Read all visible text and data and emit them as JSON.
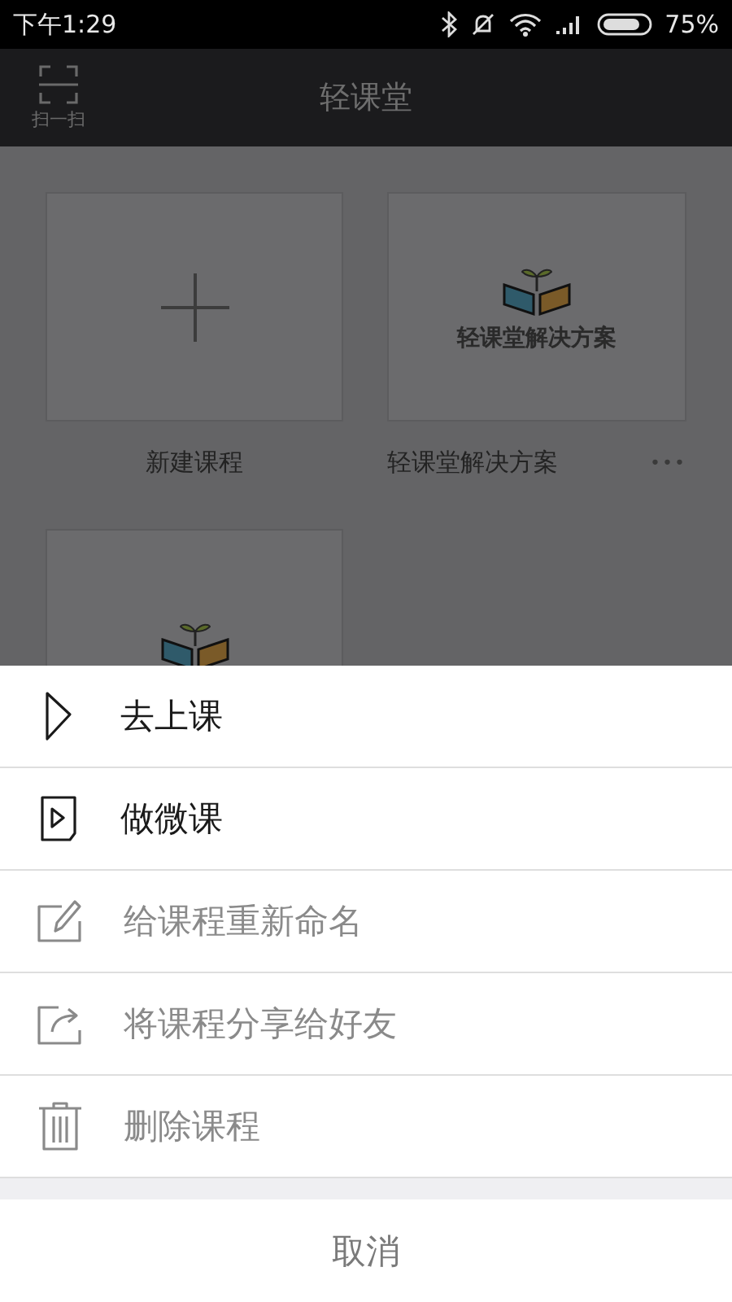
{
  "status_bar": {
    "time": "下午1:29",
    "battery": "75%"
  },
  "app_bar": {
    "title": "轻课堂",
    "scan_label": "扫一扫"
  },
  "courses": [
    {
      "kind": "new",
      "label": "新建课程"
    },
    {
      "kind": "course",
      "cover_title": "轻课堂解决方案",
      "label": "轻课堂解决方案",
      "more": "•••"
    },
    {
      "kind": "course"
    }
  ],
  "action_sheet": {
    "items": [
      {
        "kind": "play",
        "label": "去上课",
        "disabled": false
      },
      {
        "kind": "video",
        "label": "做微课",
        "disabled": false
      },
      {
        "kind": "rename",
        "label": "给课程重新命名",
        "disabled": true
      },
      {
        "kind": "share",
        "label": "将课程分享给好友",
        "disabled": true
      },
      {
        "kind": "delete",
        "label": "删除课程",
        "disabled": true
      }
    ],
    "cancel": "取消"
  }
}
